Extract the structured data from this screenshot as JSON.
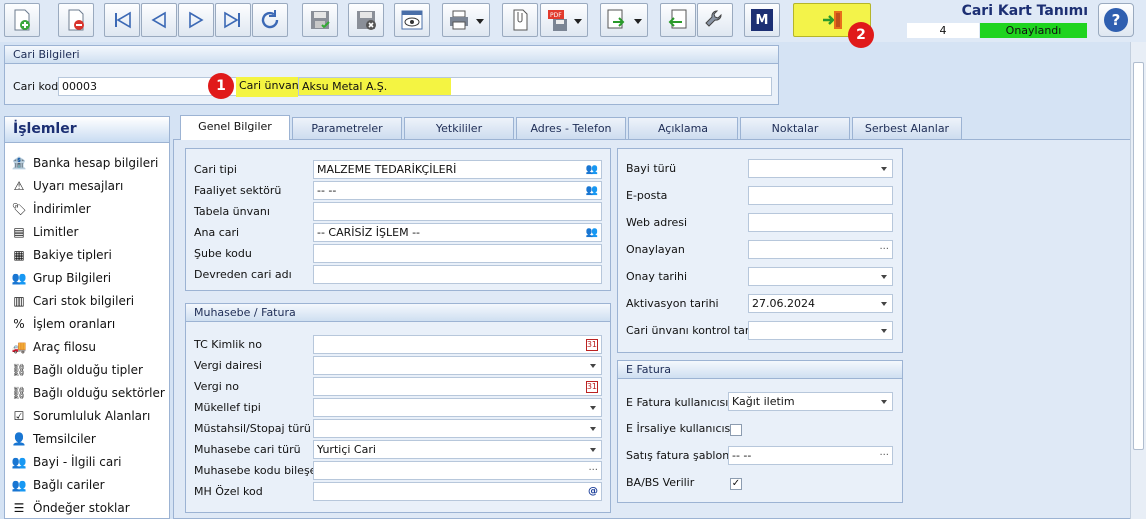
{
  "header": {
    "title": "Cari Kart Tanımı",
    "record_no": "4",
    "status": "Onaylandı"
  },
  "badges": [
    "1",
    "2"
  ],
  "toolbar": {
    "icons": [
      "new-icon",
      "delete-icon",
      "first-icon",
      "prev-icon",
      "next-icon",
      "last-icon",
      "refresh-icon",
      "save-icon",
      "cancel-save-icon",
      "preview-icon",
      "print-icon",
      "attach-icon",
      "pdf-icon",
      "export-icon",
      "import-icon",
      "tools-icon",
      "m-icon",
      "exit-icon",
      "help-icon"
    ],
    "m_label": "M",
    "help_label": "?"
  },
  "cari_bilgileri": {
    "title": "Cari Bilgileri",
    "code_label": "Cari kod",
    "code_value": "00003",
    "name_label": "Cari ünvanı",
    "name_value": "Aksu Metal A.Ş."
  },
  "sidebar": {
    "title": "İşlemler",
    "items": [
      {
        "label": "Banka hesap bilgileri",
        "icon": "bank-icon"
      },
      {
        "label": "Uyarı mesajları",
        "icon": "warning-icon"
      },
      {
        "label": "İndirimler",
        "icon": "discount-icon"
      },
      {
        "label": "Limitler",
        "icon": "limit-icon"
      },
      {
        "label": "Bakiye tipleri",
        "icon": "balance-icon"
      },
      {
        "label": "Grup Bilgileri",
        "icon": "group-icon"
      },
      {
        "label": "Cari stok bilgileri",
        "icon": "stock-icon"
      },
      {
        "label": "İşlem oranları",
        "icon": "percent-icon"
      },
      {
        "label": "Araç filosu",
        "icon": "vehicle-icon"
      },
      {
        "label": "Bağlı olduğu tipler",
        "icon": "link-icon"
      },
      {
        "label": "Bağlı olduğu sektörler",
        "icon": "sector-icon"
      },
      {
        "label": "Sorumluluk Alanları",
        "icon": "responsibility-icon"
      },
      {
        "label": "Temsilciler",
        "icon": "person-icon"
      },
      {
        "label": "Bayi - İlgili cari",
        "icon": "dealer-icon"
      },
      {
        "label": "Bağlı cariler",
        "icon": "linked-icon"
      },
      {
        "label": "Öndeğer stoklar",
        "icon": "default-stock-icon"
      }
    ]
  },
  "tabs": [
    "Genel Bilgiler",
    "Parametreler",
    "Yetkililer",
    "Adres - Telefon",
    "Açıklama",
    "Noktalar",
    "Serbest Alanlar"
  ],
  "genel": {
    "fields": [
      {
        "label": "Cari tipi",
        "value": "MALZEME TEDARİKÇİLERİ"
      },
      {
        "label": "Faaliyet sektörü",
        "value": "-- --"
      },
      {
        "label": "Tabela ünvanı",
        "value": ""
      },
      {
        "label": "Ana cari",
        "value": "-- CARİSİZ İŞLEM --"
      },
      {
        "label": "Şube kodu",
        "value": ""
      },
      {
        "label": "Devreden cari adı",
        "value": ""
      }
    ]
  },
  "muhasebe": {
    "title": "Muhasebe / Fatura",
    "fields": [
      {
        "label": "TC Kimlik no",
        "value": ""
      },
      {
        "label": "Vergi dairesi",
        "value": ""
      },
      {
        "label": "Vergi no",
        "value": ""
      },
      {
        "label": "Mükellef tipi",
        "value": ""
      },
      {
        "label": "Müstahsil/Stopaj türü",
        "value": ""
      },
      {
        "label": "Muhasebe cari türü",
        "value": "Yurtiçi Cari"
      },
      {
        "label": "Muhasebe kodu bileşeni",
        "value": ""
      },
      {
        "label": "MH Özel kod",
        "value": ""
      }
    ]
  },
  "bayi": {
    "fields": [
      {
        "label": "Bayi türü",
        "value": ""
      },
      {
        "label": "E-posta",
        "value": ""
      },
      {
        "label": "Web adresi",
        "value": ""
      },
      {
        "label": "Onaylayan",
        "value": ""
      },
      {
        "label": "Onay tarihi",
        "value": ""
      },
      {
        "label": "Aktivasyon tarihi",
        "value": "27.06.2024"
      },
      {
        "label": "Cari ünvanı kontrol tarihi",
        "value": ""
      }
    ]
  },
  "efatura": {
    "title": "E Fatura",
    "user_label": "E Fatura kullanıcısı",
    "user_value": "Kağıt iletim",
    "irsaliye_label": "E İrsaliye kullanıcısı",
    "sablon_label": "Satış fatura şablonu",
    "sablon_value": "-- --",
    "babs_label": "BA/BS Verilir",
    "check_mark": "✓"
  },
  "glyphs": {
    "ellipsis": "···",
    "at": "@",
    "calendar": "31",
    "people": "👥"
  }
}
